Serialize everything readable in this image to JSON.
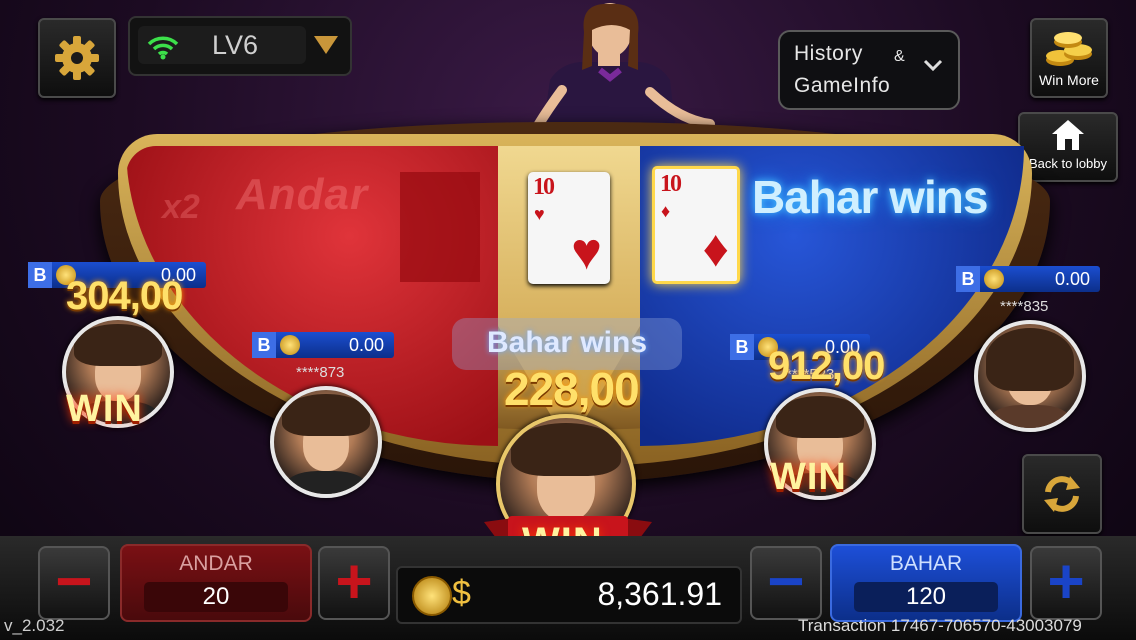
{
  "top_bar": {
    "settings_icon": "gear-icon",
    "wifi_icon": "wifi-signal-icon",
    "level": "LV6",
    "history_line1": "History",
    "history_amp": "&",
    "history_line2": "GameInfo",
    "win_more": "Win More",
    "back_to_lobby": "Back to lobby"
  },
  "table": {
    "andar_multiplier": "x2",
    "andar_label": "Andar",
    "result_banner": "Bahar wins",
    "result_badge": "Bahar wins",
    "cards": [
      {
        "rank": "10",
        "suit": "♥",
        "side": "joker"
      },
      {
        "rank": "10",
        "suit": "♦",
        "side": "bahar"
      }
    ]
  },
  "players": [
    {
      "id": "left-top",
      "balance": "0.00",
      "name": "",
      "win_amount": "304,00",
      "win_label": "WIN"
    },
    {
      "id": "left-bottom",
      "balance": "0.00",
      "name": "****873"
    },
    {
      "id": "self",
      "win_amount": "228,00",
      "win_label": "WIN"
    },
    {
      "id": "right-bottom",
      "balance": "0.00",
      "name": "****523",
      "win_amount": "912,00",
      "win_label": "WIN"
    },
    {
      "id": "right-top",
      "balance": "0.00",
      "name": "****835"
    }
  ],
  "bottom_bar": {
    "andar_label": "ANDAR",
    "andar_bet": "20",
    "bahar_label": "BAHAR",
    "bahar_bet": "120",
    "currency": "$",
    "balance": "8,361.91"
  },
  "footer": {
    "version": "v_2.032",
    "transaction": "Transaction 17467-706570-43003079"
  },
  "colors": {
    "andar": "#c8141c",
    "bahar": "#1a44c8",
    "gold": "#ffd84a",
    "win_text": "#ffe06a"
  }
}
